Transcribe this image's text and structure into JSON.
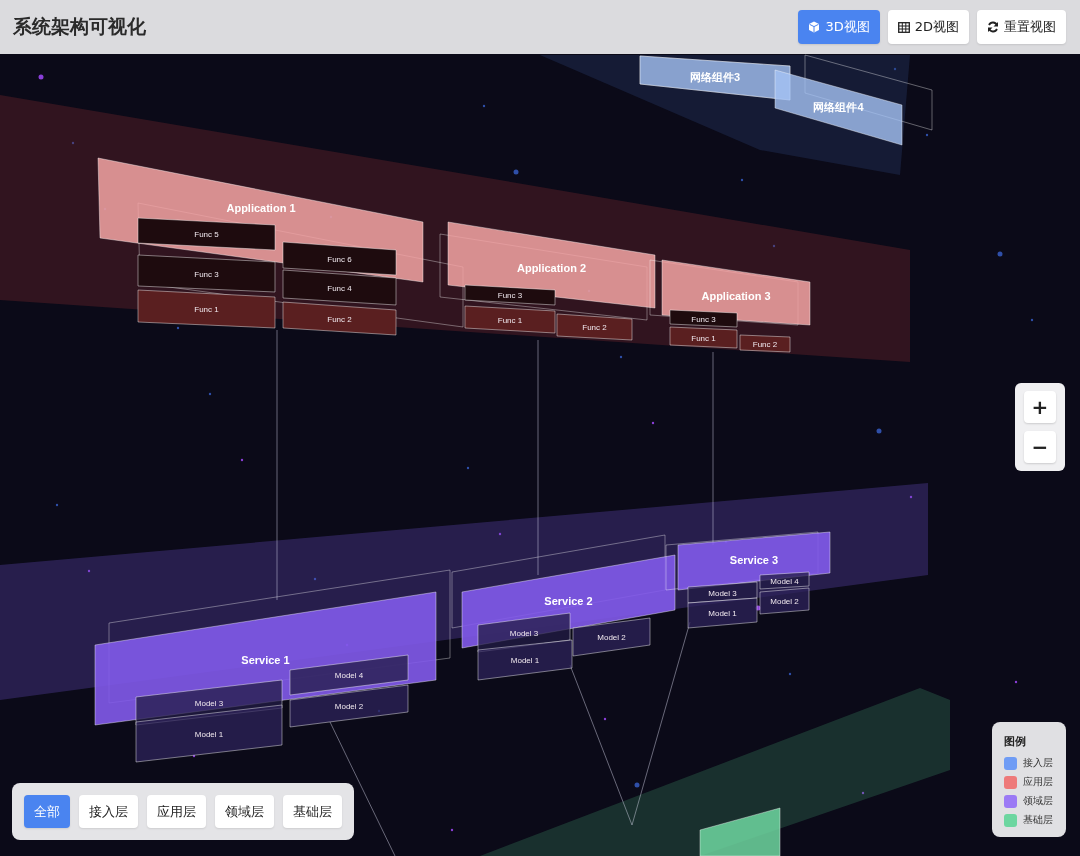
{
  "header": {
    "title": "系统架构可视化",
    "view_buttons": [
      {
        "kind": "cube",
        "label": "3D视图",
        "selected": true
      },
      {
        "kind": "grid",
        "label": "2D视图",
        "selected": false
      },
      {
        "kind": "reset",
        "label": "重置视图",
        "selected": false
      }
    ]
  },
  "scene": {
    "layers": [
      {
        "kind": "access",
        "nodes": [
          {
            "label": "网络组件3"
          },
          {
            "label": "网络组件4"
          }
        ]
      },
      {
        "kind": "application",
        "nodes": [
          {
            "label": "Application 1",
            "children": [
              {
                "label": "Func 5"
              },
              {
                "label": "Func 6"
              },
              {
                "label": "Func 3"
              },
              {
                "label": "Func 4"
              },
              {
                "label": "Func 1"
              },
              {
                "label": "Func 2"
              }
            ]
          },
          {
            "label": "Application 2",
            "children": [
              {
                "label": "Func 3"
              },
              {
                "label": "Func 1"
              },
              {
                "label": "Func 2"
              }
            ]
          },
          {
            "label": "Application 3",
            "children": [
              {
                "label": "Func 3"
              },
              {
                "label": "Func 1"
              },
              {
                "label": "Func 2"
              }
            ]
          }
        ]
      },
      {
        "kind": "domain",
        "nodes": [
          {
            "label": "Service 1",
            "children": [
              {
                "label": "Model 4"
              },
              {
                "label": "Model 3"
              },
              {
                "label": "Model 2"
              },
              {
                "label": "Model 1"
              }
            ]
          },
          {
            "label": "Service 2",
            "children": [
              {
                "label": "Model 3"
              },
              {
                "label": "Model 2"
              },
              {
                "label": "Model 1"
              }
            ]
          },
          {
            "label": "Service 3",
            "children": [
              {
                "label": "Model 4"
              },
              {
                "label": "Model 3"
              },
              {
                "label": "Model 2"
              },
              {
                "label": "Model 1"
              }
            ]
          }
        ]
      },
      {
        "kind": "base"
      }
    ]
  },
  "zoom_controls": [
    "+",
    "−"
  ],
  "filters": [
    {
      "label": "全部",
      "selected": true
    },
    {
      "label": "接入层",
      "selected": false
    },
    {
      "label": "应用层",
      "selected": false
    },
    {
      "label": "领域层",
      "selected": false
    },
    {
      "label": "基础层",
      "selected": false
    }
  ],
  "legend": {
    "title": "图例",
    "items": [
      {
        "label": "接入层",
        "color": "#6f9cf5"
      },
      {
        "label": "应用层",
        "color": "#ee7a7a"
      },
      {
        "label": "领域层",
        "color": "#9b7af5"
      },
      {
        "label": "基础层",
        "color": "#6cd6a0"
      }
    ]
  }
}
